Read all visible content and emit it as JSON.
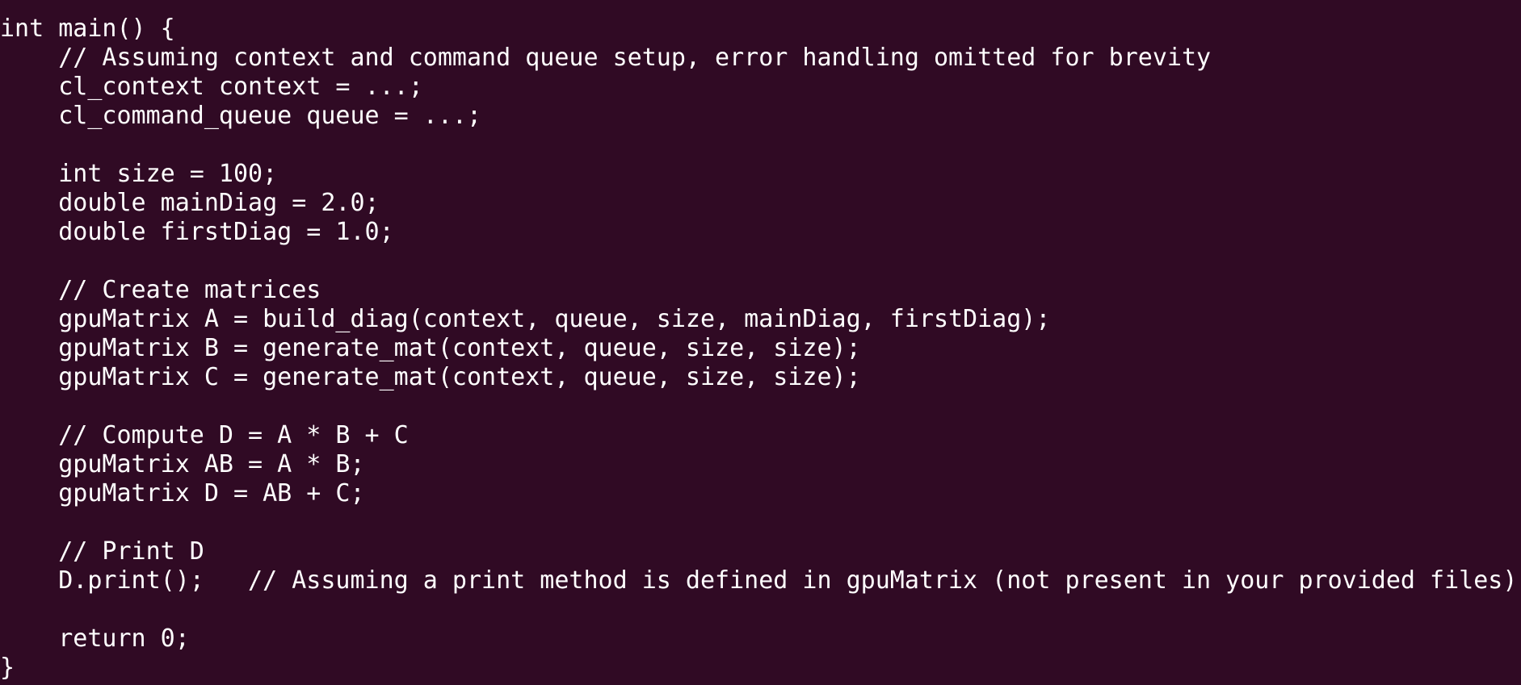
{
  "colors": {
    "background": "#300a24",
    "foreground": "#ffffff"
  },
  "code_lines": [
    "int main() {",
    "    // Assuming context and command queue setup, error handling omitted for brevity",
    "    cl_context context = ...;",
    "    cl_command_queue queue = ...;",
    "",
    "    int size = 100;",
    "    double mainDiag = 2.0;",
    "    double firstDiag = 1.0;",
    "",
    "    // Create matrices",
    "    gpuMatrix A = build_diag(context, queue, size, mainDiag, firstDiag);",
    "    gpuMatrix B = generate_mat(context, queue, size, size);",
    "    gpuMatrix C = generate_mat(context, queue, size, size);",
    "",
    "    // Compute D = A * B + C",
    "    gpuMatrix AB = A * B;",
    "    gpuMatrix D = AB + C;",
    "",
    "    // Print D",
    "    D.print();   // Assuming a print method is defined in gpuMatrix (not present in your provided files)",
    "",
    "    return 0;",
    "}"
  ]
}
